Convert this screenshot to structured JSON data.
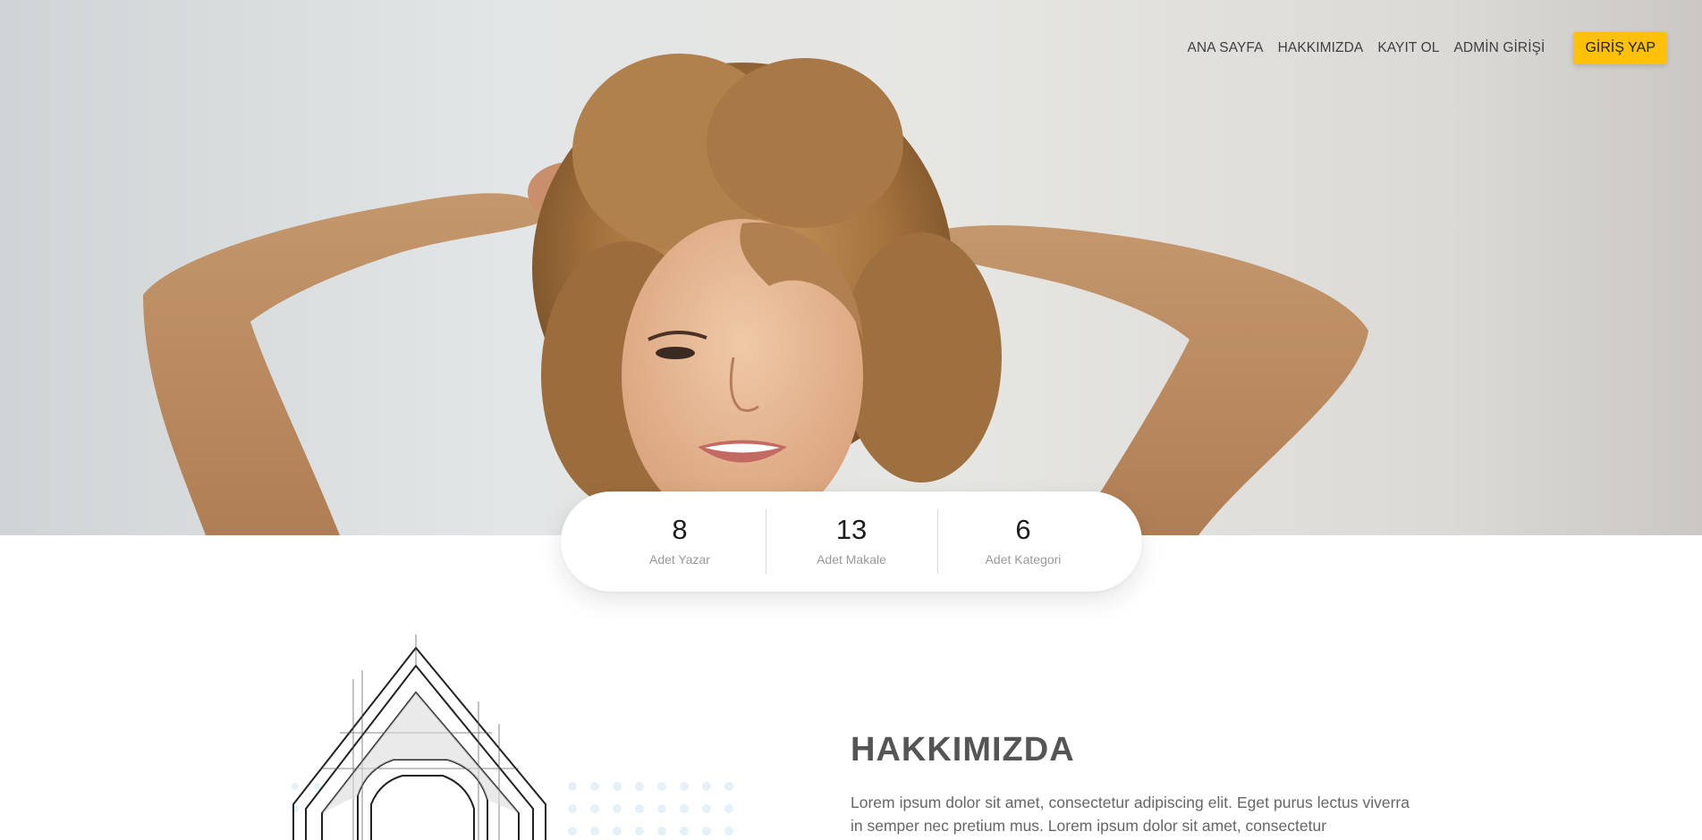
{
  "nav": {
    "links": [
      "ANA SAYFA",
      "HAKKIMIZDA",
      "KAYIT OL",
      "ADMİN GİRİŞİ"
    ],
    "cta_label": "GİRİŞ YAP"
  },
  "stats": [
    {
      "value": "8",
      "label": "Adet Yazar"
    },
    {
      "value": "13",
      "label": "Adet Makale"
    },
    {
      "value": "6",
      "label": "Adet Kategori"
    }
  ],
  "about": {
    "title": "HAKKIMIZDA",
    "body": "Lorem ipsum dolor sit amet, consectetur adipiscing elit. Eget purus lectus viverra in semper nec pretium mus. Lorem ipsum dolor sit amet, consectetur"
  },
  "colors": {
    "accent": "#ffc107",
    "sweater": "#c09066",
    "hair": "#a97a4a"
  }
}
